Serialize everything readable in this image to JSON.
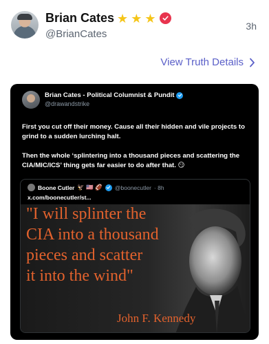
{
  "post": {
    "display_name": "Brian Cates",
    "star_glyph": "★",
    "star_count": 3,
    "handle": "@BrianCates",
    "timestamp": "3h",
    "view_details_label": "View Truth Details",
    "view_details_icon": "chevron-right-icon",
    "colors": {
      "link": "#5a5fc8",
      "star": "#f5c518",
      "badge": "#e8344e"
    }
  },
  "embed": {
    "name": "Brian Cates - Political Columnist & Pundit",
    "handle": "@drawandstrike",
    "paragraph_1": "First you cut off their money. Cause all their hidden and vile projects to grind to a sudden lurching halt.",
    "paragraph_2": "Then the whole ‘splintering into a thousand pieces and scattering the CIA/MIC/ICS’ thing gets far easier to do after that. 😏",
    "quote": {
      "name": "Boone Cutler",
      "emojis": "🦅 🇺🇸 🏈",
      "handle": "@boonecutler",
      "time": "· 8h",
      "link": "x.com/boonecutler/st...",
      "image": {
        "line_1": "\"I will splinter the",
        "line_2": "CIA into a thousand",
        "line_3": "pieces and scatter",
        "line_4": "it into the wind\"",
        "author": "John F. Kennedy"
      }
    }
  }
}
